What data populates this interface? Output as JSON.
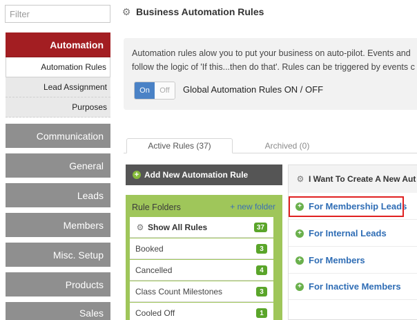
{
  "sidebar": {
    "filter_placeholder": "Filter",
    "automation": "Automation",
    "subitems": [
      "Automation Rules",
      "Lead Assignment",
      "Purposes"
    ],
    "nav": [
      "Communication",
      "General",
      "Leads",
      "Members",
      "Misc. Setup",
      "Products",
      "Sales"
    ]
  },
  "header": {
    "title": "Business Automation Rules"
  },
  "info": {
    "line1": "Automation rules alow you to put your business on auto-pilot. Events and",
    "line2": "follow the logic of 'If this...then do that'. Rules can be triggered by events c",
    "toggle_on": "On",
    "toggle_off": "Off",
    "toggle_label": "Global Automation Rules ON / OFF"
  },
  "tabs": {
    "active": "Active Rules (37)",
    "archived": "Archived (0)"
  },
  "rules": {
    "add_label": "Add New Automation Rule",
    "folders_title": "Rule Folders",
    "new_folder": "+ new folder",
    "show_all": "Show All Rules",
    "show_all_count": "37",
    "folders": [
      {
        "name": "Booked",
        "count": "3"
      },
      {
        "name": "Cancelled",
        "count": "4"
      },
      {
        "name": "Class Count Milestones",
        "count": "3"
      },
      {
        "name": "Cooled Off",
        "count": "1"
      }
    ]
  },
  "create": {
    "title": "I Want To Create A New Aut",
    "options": [
      "For Membership Leads",
      "For Internal Leads",
      "For Members",
      "For Inactive Members"
    ]
  },
  "colors": {
    "accent_red": "#a31e22",
    "nav_gray": "#8f8f8f",
    "folder_green": "#9fc65a",
    "badge_green": "#5aa52a",
    "link_blue": "#2f6db5",
    "highlight_red": "#e02020"
  }
}
